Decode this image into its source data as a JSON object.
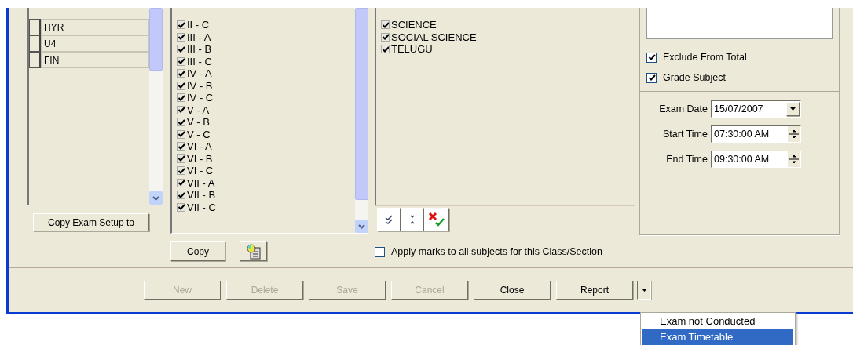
{
  "exams": [
    {
      "name": "HYR",
      "checked": false
    },
    {
      "name": "U4",
      "checked": false
    },
    {
      "name": "FIN",
      "checked": false
    }
  ],
  "copy_setup_button": "Copy Exam Setup to",
  "sections": [
    {
      "label": "II - C",
      "checked": true
    },
    {
      "label": "III - A",
      "checked": true
    },
    {
      "label": "III - B",
      "checked": true
    },
    {
      "label": "III - C",
      "checked": true
    },
    {
      "label": "IV - A",
      "checked": true
    },
    {
      "label": "IV - B",
      "checked": true
    },
    {
      "label": "IV - C",
      "checked": true
    },
    {
      "label": "V - A",
      "checked": true
    },
    {
      "label": "V - B",
      "checked": true
    },
    {
      "label": "V - C",
      "checked": true
    },
    {
      "label": "VI - A",
      "checked": true
    },
    {
      "label": "VI - B",
      "checked": true
    },
    {
      "label": "VI - C",
      "checked": true
    },
    {
      "label": "VII - A",
      "checked": true
    },
    {
      "label": "VII - B",
      "checked": true
    },
    {
      "label": "VII - C",
      "checked": true
    }
  ],
  "copy_button": "Copy",
  "subjects": [
    {
      "label": "SCIENCE",
      "checked": true
    },
    {
      "label": "SOCIAL SCIENCE",
      "checked": true
    },
    {
      "label": "TELUGU",
      "checked": true
    }
  ],
  "apply_marks": {
    "label": "Apply marks to all subjects for this Class/Section",
    "checked": false
  },
  "options": [
    {
      "label": "Exclude From Total",
      "checked": true
    },
    {
      "label": "Grade Subject",
      "checked": true
    }
  ],
  "schedule": [
    {
      "kind": "date",
      "label": "Exam Date",
      "value": "15/07/2007"
    },
    {
      "kind": "time",
      "label": "Start Time",
      "value": "07:30:00 AM"
    },
    {
      "kind": "time",
      "label": "End Time",
      "value": "09:30:00 AM"
    }
  ],
  "buttons": [
    {
      "label": "New",
      "disabled": true
    },
    {
      "label": "Delete",
      "disabled": true
    },
    {
      "label": "Save",
      "disabled": true
    },
    {
      "label": "Cancel",
      "disabled": true
    },
    {
      "label": "Close",
      "disabled": false
    },
    {
      "label": "Report",
      "disabled": false
    }
  ],
  "report_menu": {
    "expanded": true,
    "items": [
      {
        "label": "Exam not Conducted",
        "selected": false
      },
      {
        "label": "Exam Timetable",
        "selected": true
      }
    ]
  }
}
